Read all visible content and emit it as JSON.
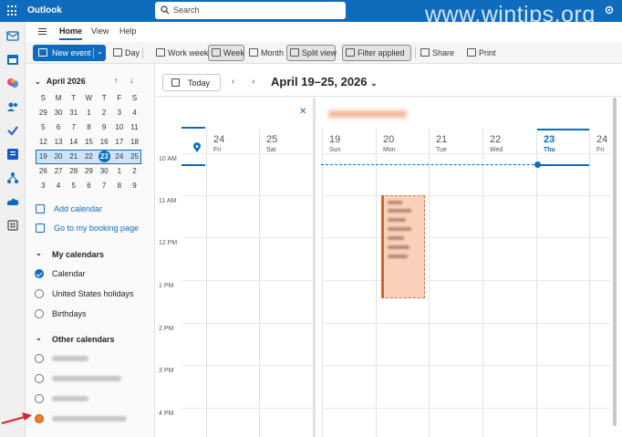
{
  "titlebar": {
    "app_name": "Outlook",
    "search_placeholder": "Search",
    "watermark": "www.wintips.org"
  },
  "ribbon": {
    "menu_tabs": [
      "Home",
      "View",
      "Help"
    ],
    "active_tab": "Home",
    "new_event_label": "New event",
    "view_buttons": [
      "Day",
      "Work week",
      "Week",
      "Month",
      "Split view"
    ],
    "selected_view": "Week",
    "filter_label": "Filter applied",
    "share_label": "Share",
    "print_label": "Print"
  },
  "minical": {
    "month_label": "April 2026",
    "weekday_headers": [
      "S",
      "M",
      "T",
      "W",
      "T",
      "F",
      "S"
    ],
    "weeks": [
      [
        "29",
        "30",
        "31",
        "1",
        "2",
        "3",
        "4"
      ],
      [
        "5",
        "6",
        "7",
        "8",
        "9",
        "10",
        "11"
      ],
      [
        "12",
        "13",
        "14",
        "15",
        "16",
        "17",
        "18"
      ],
      [
        "19",
        "20",
        "21",
        "22",
        "23",
        "24",
        "25"
      ],
      [
        "26",
        "27",
        "28",
        "29",
        "30",
        "1",
        "2"
      ],
      [
        "3",
        "4",
        "5",
        "6",
        "7",
        "8",
        "9"
      ]
    ],
    "selected_week_index": 3,
    "today": "23"
  },
  "leftpane": {
    "add_calendar": "Add calendar",
    "booking_page": "Go to my booking page",
    "my_calendars_title": "My calendars",
    "my_calendars": [
      {
        "name": "Calendar",
        "checked": true
      },
      {
        "name": "United States holidays",
        "checked": false
      },
      {
        "name": "Birthdays",
        "checked": false
      }
    ],
    "other_calendars_title": "Other calendars"
  },
  "main": {
    "today_label": "Today",
    "date_range": "April 19–25, 2026",
    "split_days": [
      {
        "num": "24",
        "day": "Fri"
      },
      {
        "num": "25",
        "day": "Sat"
      }
    ],
    "days": [
      {
        "num": "19",
        "day": "Sun"
      },
      {
        "num": "20",
        "day": "Mon"
      },
      {
        "num": "21",
        "day": "Tue"
      },
      {
        "num": "22",
        "day": "Wed"
      },
      {
        "num": "23",
        "day": "Thu"
      },
      {
        "num": "24",
        "day": "Fri"
      }
    ],
    "today_index": 4,
    "time_labels": [
      "10 AM",
      "11 AM",
      "12 PM",
      "1 PM",
      "2 PM",
      "3 PM",
      "4 PM"
    ]
  },
  "colors": {
    "accent": "#0f6cbd",
    "event_fill": "#fbd0bb",
    "event_border": "#e55f1c",
    "arrow": "#e0202a"
  }
}
